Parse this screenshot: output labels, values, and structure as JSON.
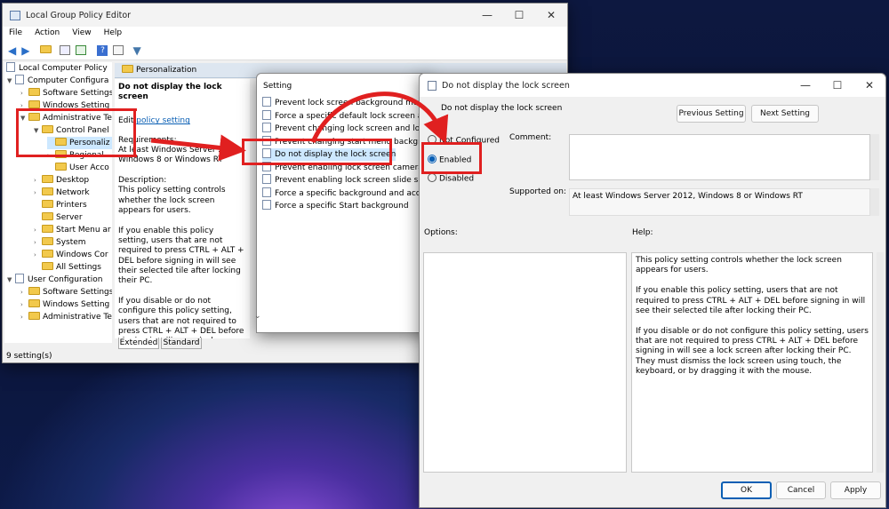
{
  "gpedit": {
    "title": "Local Group Policy Editor",
    "menu": [
      "File",
      "Action",
      "View",
      "Help"
    ],
    "tree": [
      "Local Computer Policy",
      "Computer Configura",
      "Software Settings",
      "Windows Setting",
      "Administrative Te",
      "Control Panel",
      "Personaliz",
      "Regional",
      "User Acco",
      "Desktop",
      "Network",
      "Printers",
      "Server",
      "Start Menu ar",
      "System",
      "Windows Cor",
      "All Settings",
      "User Configuration",
      "Software Settings",
      "Windows Setting",
      "Administrative Te"
    ],
    "header": "Personalization",
    "desc": {
      "title": "Do not display the lock screen",
      "edit_prefix": "Edit ",
      "edit_link": "policy setting",
      "req_label": "Requirements:",
      "req_text": "At least Windows Server 2012, Windows 8 or Windows RT",
      "desc_label": "Description:",
      "p1": "This policy setting controls whether the lock screen appears for users.",
      "p2": "If you enable this policy setting, users that are not required to press CTRL + ALT + DEL before signing in will see their selected tile after locking their PC.",
      "p3": "If you disable or do not configure this policy setting, users that are not required to press CTRL + ALT + DEL before signing in will see a lock screen after locking their PC. They must dismiss the lock screen"
    },
    "list_header": "Setting",
    "settings": [
      "Prevent lock screen background motion",
      "Force a specific default lock screen and lo",
      "Prevent changing lock screen and logon",
      "Prevent changing start menu background",
      "Do not display the lock screen",
      "Prevent enabling lock screen camera",
      "Prevent enabling lock screen slide show",
      "Force a specific background and accent c",
      "Force a specific Start background"
    ],
    "tabs": [
      "Extended",
      "Standard"
    ],
    "status": "9 setting(s)"
  },
  "dialog": {
    "title": "Do not display the lock screen",
    "policy_name": "Do not display the lock screen",
    "prev_button": "Previous Setting",
    "next_button": "Next Setting",
    "radios": [
      "Not Configured",
      "Enabled",
      "Disabled"
    ],
    "selected": "Enabled",
    "comment_label": "Comment:",
    "comment_value": "",
    "supported_label": "Supported on:",
    "supported_value": "At least Windows Server 2012, Windows 8 or Windows RT",
    "options_label": "Options:",
    "help_label": "Help:",
    "help": [
      "This policy setting controls whether the lock screen appears for users.",
      "If you enable this policy setting, users that are not required to press CTRL + ALT + DEL before signing in will see their selected tile after locking their PC.",
      "If you disable or do not configure this policy setting, users that are not required to press CTRL + ALT + DEL before signing in will see a lock screen after locking their PC. They must dismiss the lock screen using touch, the keyboard, or by dragging it with the mouse."
    ],
    "ok": "OK",
    "cancel": "Cancel",
    "apply": "Apply"
  },
  "colors": {
    "highlight": "#e02020",
    "accent": "#0a5fb4",
    "selection": "#cde8ff"
  }
}
